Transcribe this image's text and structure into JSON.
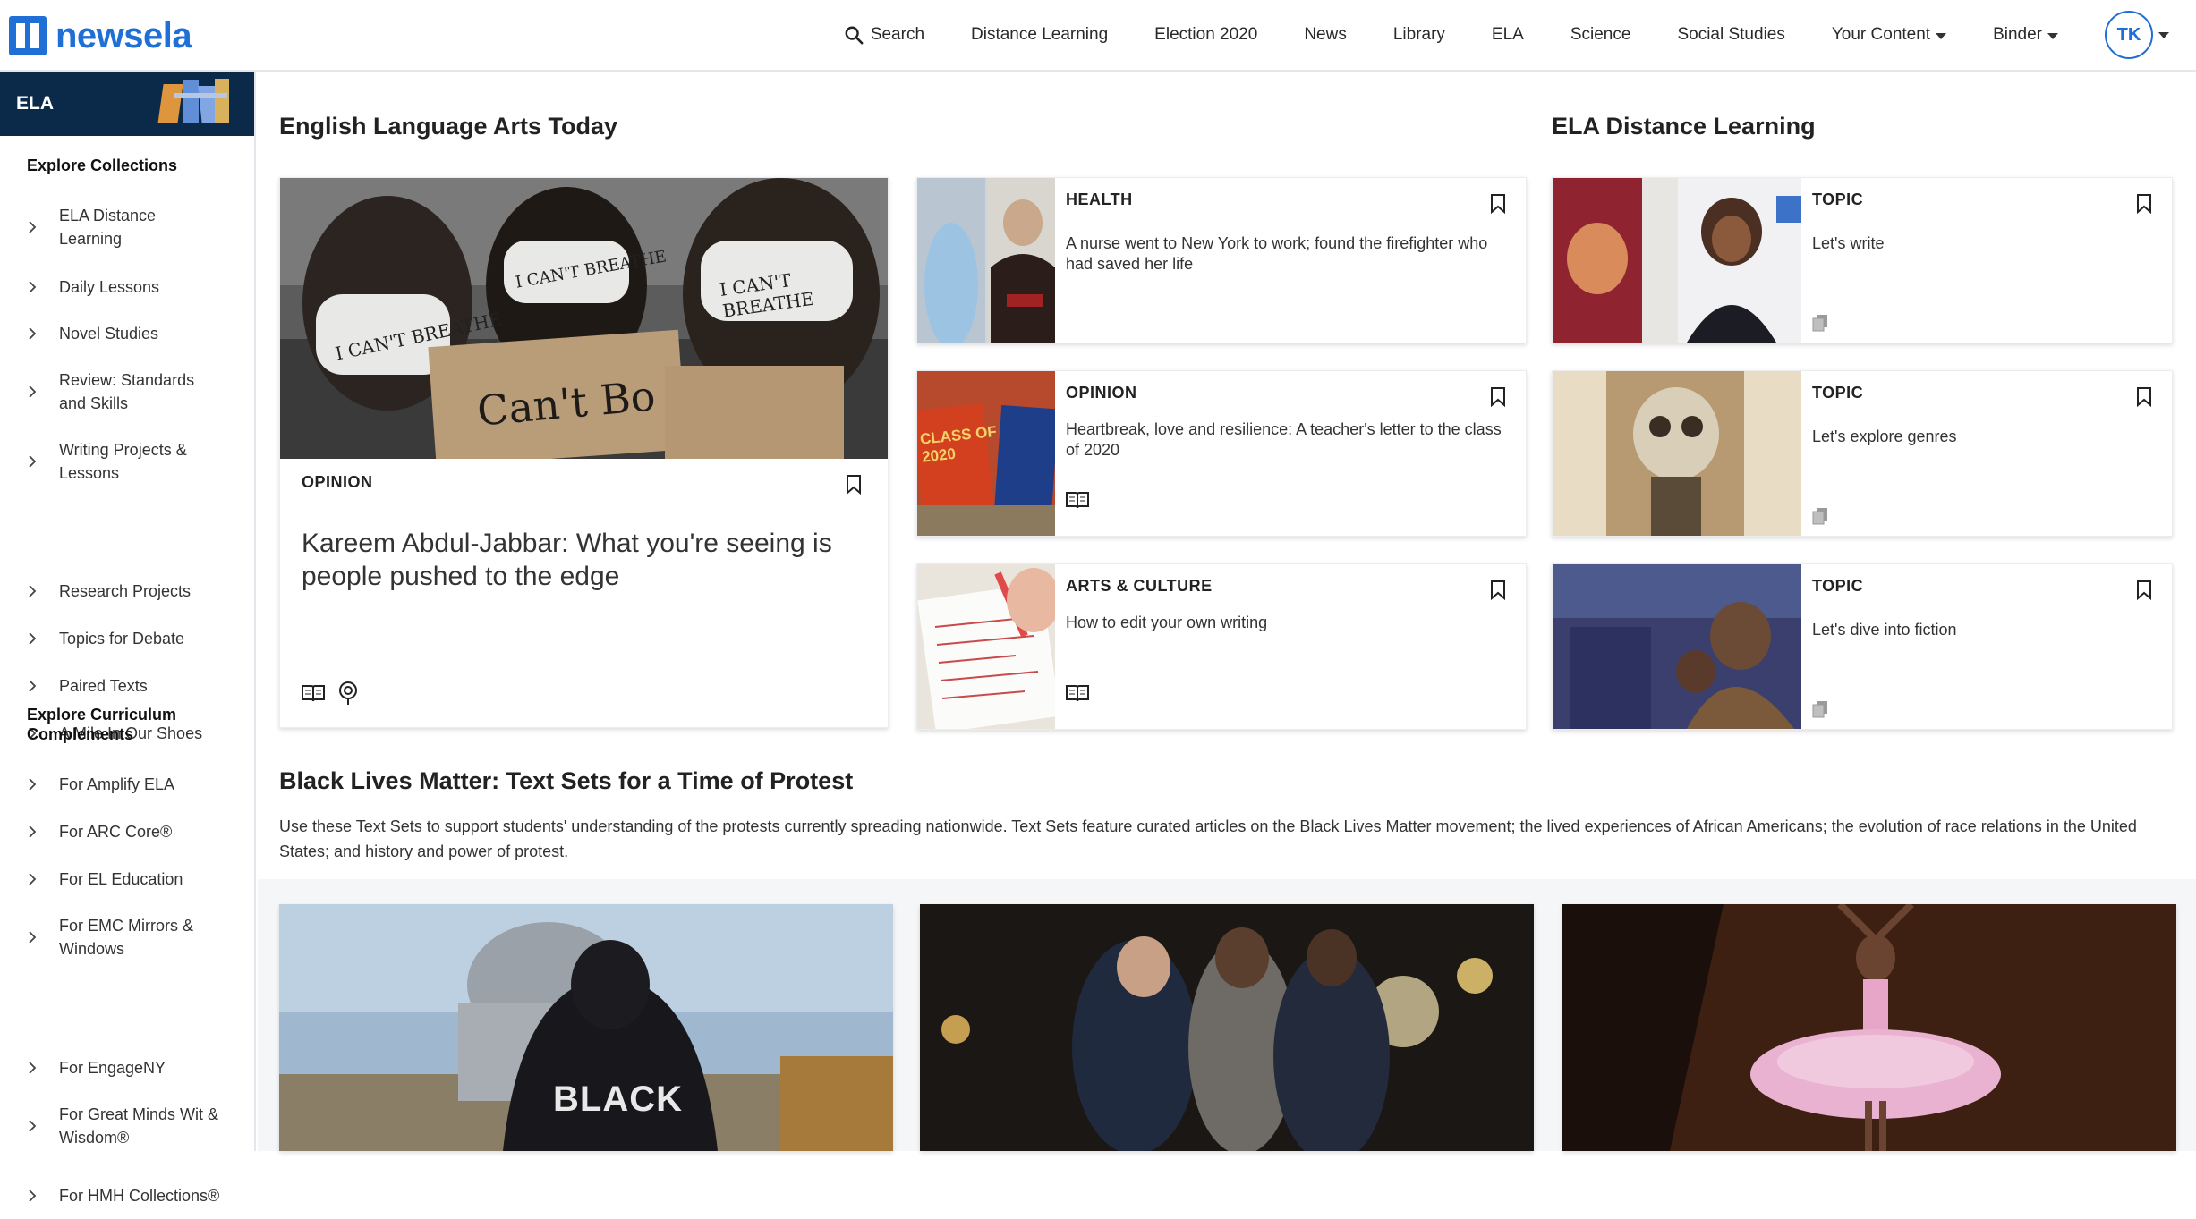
{
  "brand": {
    "name": "newsela",
    "color": "#1f6fd6"
  },
  "nav": {
    "search_label": "Search",
    "items": [
      "Distance Learning",
      "Election 2020",
      "News",
      "Library",
      "ELA",
      "Science",
      "Social Studies"
    ],
    "your_content": "Your Content",
    "binder": "Binder",
    "avatar_initials": "TK"
  },
  "sidebar": {
    "title": "ELA",
    "collections_heading": "Explore Collections",
    "collections": [
      "ELA Distance Learning",
      "Daily Lessons",
      "Novel Studies",
      "Review: Standards and Skills",
      "Writing Projects & Lessons",
      "Research Projects",
      "Topics for Debate",
      "Paired Texts",
      "A Mile In Our Shoes"
    ],
    "complements_heading": "Explore Curriculum Complements",
    "complements": [
      "For Amplify ELA",
      "For ARC Core®",
      "For EL Education",
      "For EMC Mirrors & Windows",
      "For EngageNY",
      "For Great Minds Wit & Wisdom®",
      "For HMH Collections®"
    ]
  },
  "ela_today": {
    "title": "English Language Arts Today",
    "featured": {
      "category": "OPINION",
      "title": "Kareem Abdul-Jabbar: What you're seeing is people pushed to the edge"
    },
    "articles": [
      {
        "category": "HEALTH",
        "title": "A nurse went to New York to work; found the firefighter who had saved her life"
      },
      {
        "category": "OPINION",
        "title": "Heartbreak, love and resilience: A teacher's letter to the class of 2020"
      },
      {
        "category": "ARTS & CULTURE",
        "title": "How to edit your own writing"
      }
    ]
  },
  "distance": {
    "title": "ELA Distance Learning",
    "topics": [
      {
        "category": "TOPIC",
        "title": "Let's write"
      },
      {
        "category": "TOPIC",
        "title": "Let's explore genres"
      },
      {
        "category": "TOPIC",
        "title": "Let's dive into fiction"
      }
    ]
  },
  "blm": {
    "title": "Black Lives Matter: Text Sets for a Time of Protest",
    "description": "Use these Text Sets to support students' understanding of the protests currently spreading nationwide. Text Sets feature curated articles on the Black Lives Matter movement; the lived experiences of African Americans; the evolution of race relations in the United States; and history and power of protest.",
    "hoodie_text": "BLACK"
  },
  "mask_texts": [
    "I CAN'T BREATHE",
    "I CAN'T BREATHE",
    "I CAN'T BREATHE"
  ],
  "sign_text": "Can't Bo",
  "class_sign": "CLASS OF 2020"
}
